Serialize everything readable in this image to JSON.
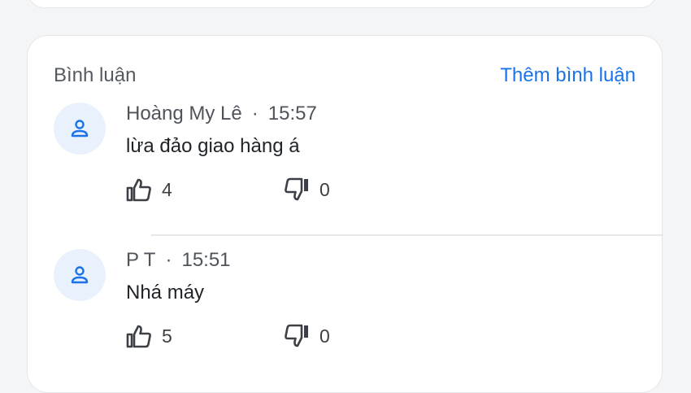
{
  "header": {
    "title": "Bình luận",
    "add_label": "Thêm bình luận"
  },
  "colors": {
    "accent": "#1a73e8",
    "avatar_bg": "#e9f1fc",
    "text": "#1f2328",
    "muted": "#4f545b"
  },
  "comments": [
    {
      "author": "Hoàng My Lê",
      "separator": "·",
      "time": "15:57",
      "text": "lừa đảo giao hàng á",
      "likes": "4",
      "dislikes": "0"
    },
    {
      "author": "P T",
      "separator": "·",
      "time": "15:51",
      "text": "Nhá máy",
      "likes": "5",
      "dislikes": "0"
    }
  ],
  "icons": {
    "avatar": "person-icon",
    "like": "thumbs-up-icon",
    "dislike": "thumbs-down-icon"
  }
}
